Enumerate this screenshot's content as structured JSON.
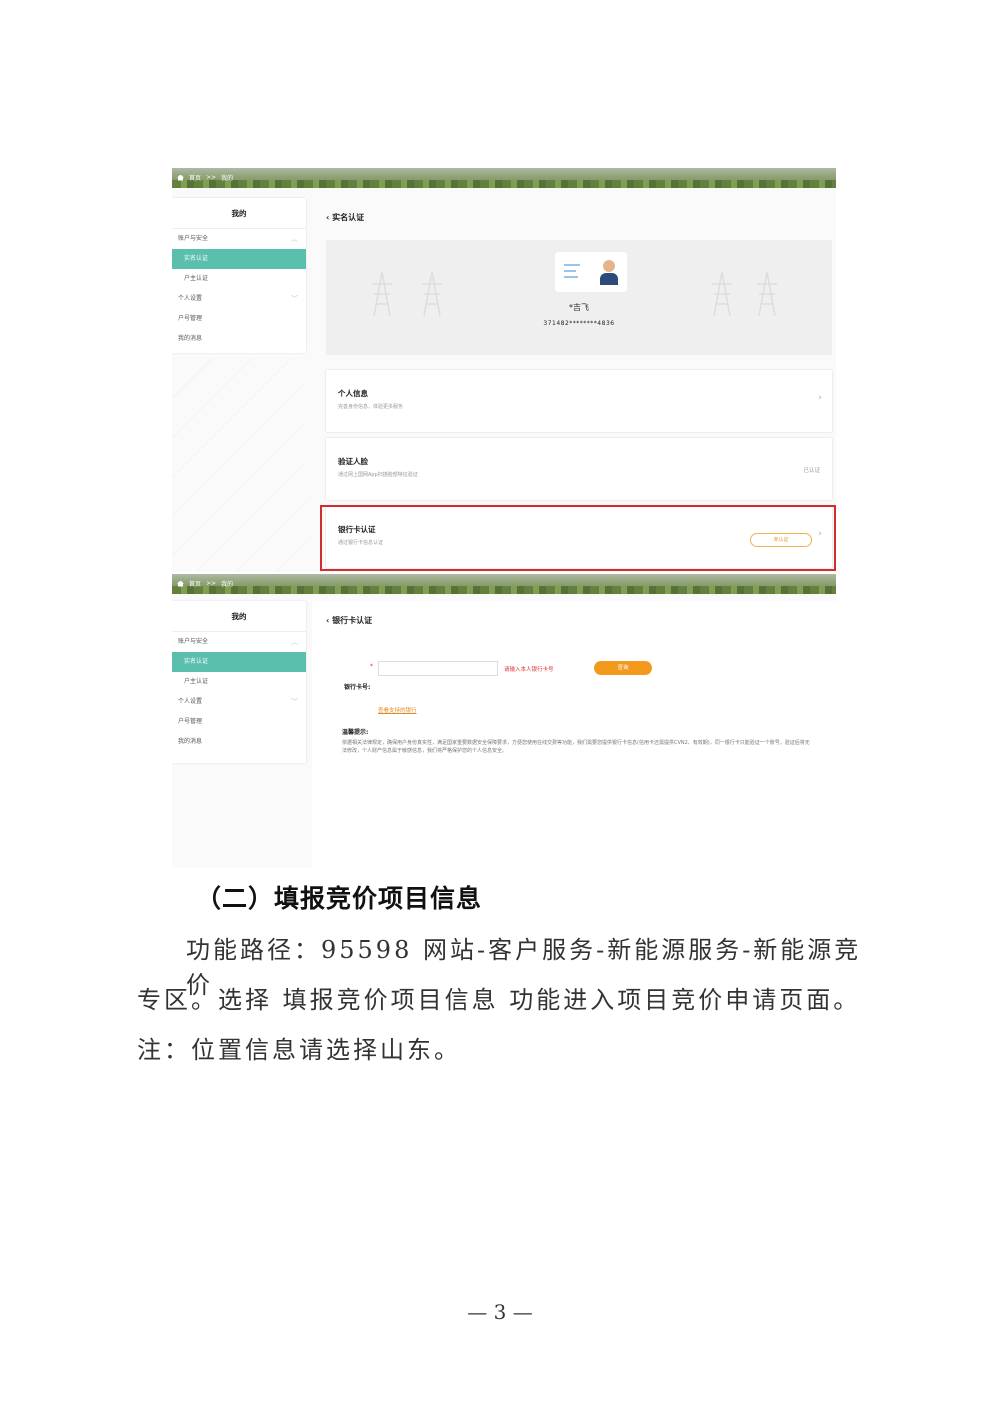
{
  "breadcrumb": {
    "home": "首页",
    "sep": ">>",
    "current": "我的"
  },
  "sidebar": {
    "title": "我的",
    "items": [
      {
        "label": "账户与安全",
        "chevron": "︿"
      },
      {
        "label": "实名认证"
      },
      {
        "label": "户主认证"
      },
      {
        "label": "个人设置",
        "chevron": "﹀"
      },
      {
        "label": "户号管理"
      },
      {
        "label": "我的消息"
      }
    ]
  },
  "screen1": {
    "title": "实名认证",
    "id_card": {
      "name": "*吉飞",
      "id_number": "371482********4836"
    },
    "rows": [
      {
        "title": "个人信息",
        "subtitle": "完善身份信息，体验更多服务"
      },
      {
        "title": "验证人脸",
        "subtitle": "通过网上国网App扫描脸部特征验证",
        "status": "已认证"
      },
      {
        "title": "银行卡认证",
        "subtitle": "通过银行卡信息认证",
        "status": "未认证"
      }
    ]
  },
  "screen2": {
    "title": "银行卡认证",
    "required_mark": "*",
    "card_label": "银行卡号:",
    "input_hint": "请输入本人银行卡号",
    "query_button": "查询",
    "support_link": "查看支持的银行",
    "tips_title": "温馨提示:",
    "tips_text": "依据相关法律规定，确保用户身份真实性，满足国家重要数据安全保障要求，方便您使用在线交费等功能，我们需要您提供银行卡信息(信用卡还需提供CVN2、有效期)，同一银行卡只能验证一个账号，验证后将无法修改，个人财产信息属于敏感信息，我们将严格保护您的个人信息安全。"
  },
  "doc": {
    "heading": "（二）填报竞价项目信息",
    "para1": "功能路径：95598 网站-客户服务-新能源服务-新能源竞价",
    "para2": "专区。选择  填报竞价项目信息  功能进入项目竞价申请页面。",
    "para3": "注：位置信息请选择山东。",
    "page_number": "— 3 —"
  }
}
